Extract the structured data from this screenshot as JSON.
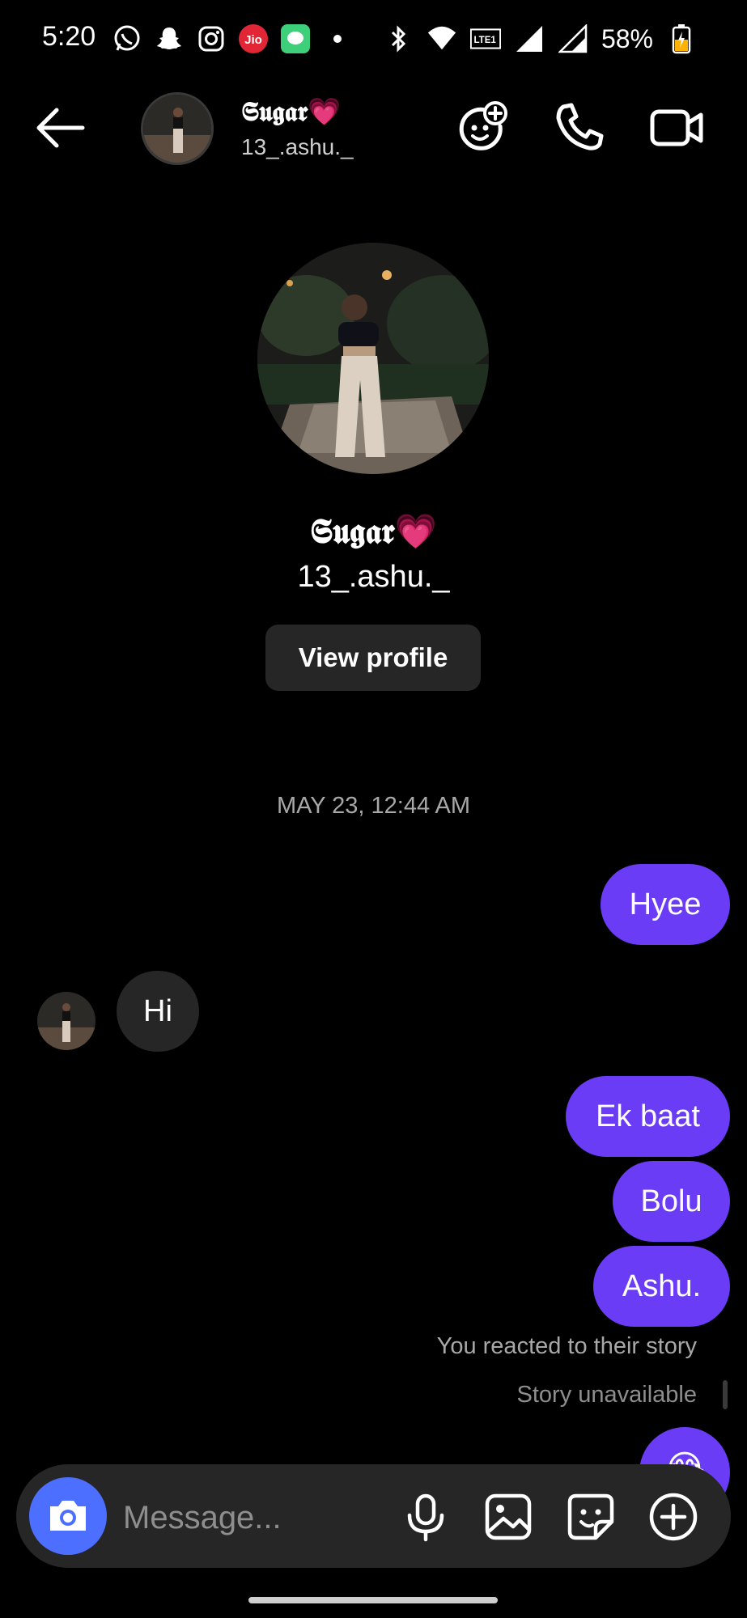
{
  "status_bar": {
    "time": "5:20",
    "battery": "58%",
    "left_icons": [
      "whatsapp-icon",
      "snapchat-icon",
      "instagram-icon",
      "jio-icon",
      "messages-icon",
      "dot-icon"
    ],
    "right_icons": [
      "bluetooth-icon",
      "wifi-icon",
      "volte-icon",
      "signal-icon",
      "signal-roaming-icon",
      "battery-charging-icon"
    ]
  },
  "header": {
    "name": "𝕾𝖚𝖌𝖆𝖗💗",
    "username": "13_.ashu._",
    "icons": [
      "back-arrow-icon",
      "add-effects-icon",
      "phone-call-icon",
      "video-call-icon"
    ]
  },
  "profile": {
    "name": "𝕾𝖚𝖌𝖆𝖗💗",
    "username": "13_.ashu._",
    "view_profile_label": "View profile"
  },
  "thread": {
    "date_separator": "MAY 23, 12:44 AM",
    "messages": [
      {
        "from": "me",
        "text": "Hyee"
      },
      {
        "from": "them",
        "text": "Hi"
      },
      {
        "from": "me",
        "text": "Ek baat"
      },
      {
        "from": "me",
        "text": "Bolu"
      },
      {
        "from": "me",
        "text": "Ashu."
      }
    ],
    "story_reaction_text": "You reacted to their story",
    "story_status": "Story unavailable",
    "reaction_emoji": "😂"
  },
  "composer": {
    "placeholder": "Message...",
    "icons": [
      "camera-icon",
      "microphone-icon",
      "gallery-icon",
      "sticker-icon",
      "plus-icon"
    ]
  },
  "colors": {
    "background": "#000000",
    "outgoing_bubble": "#6b3cf6",
    "incoming_bubble": "#262626",
    "camera_button": "#4c6fff",
    "secondary_text": "#a8a8a8"
  }
}
